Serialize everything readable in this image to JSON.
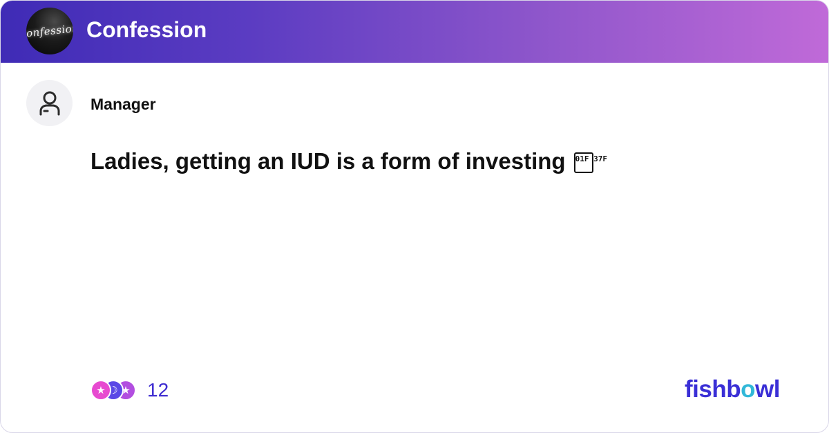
{
  "header": {
    "bowl_logo_text": "confession",
    "bowl_title": "Confession"
  },
  "post": {
    "author": "Manager",
    "text": "Ladies, getting an IUD is a form of investing",
    "emoji_glyph": "01F 37F"
  },
  "reactions": {
    "count": "12",
    "icons": [
      "star-reaction-icon",
      "crescent-reaction-icon",
      "star-reaction-icon"
    ],
    "colors": [
      "#e74ad0",
      "#5a48e6",
      "#b24ee0"
    ]
  },
  "brand": {
    "name_prefix": "fishb",
    "name_o": "o",
    "name_suffix": "wl",
    "color": "#3a2fd6",
    "accent": "#31b8d8"
  },
  "colors": {
    "header_start": "#3f2bb6",
    "header_end": "#c06ad8"
  }
}
